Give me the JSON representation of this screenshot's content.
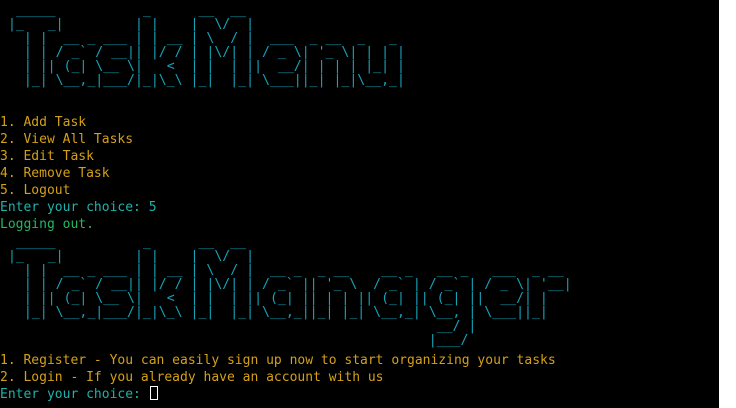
{
  "colors": {
    "background": "#000000",
    "art": "#17a2b8",
    "menu": "#d4a017",
    "prompt": "#20b2aa",
    "status": "#23b860",
    "scrollbar": "#ffffff"
  },
  "banner1": {
    "art": "  _____           _      __  __\n |_   _|         | |    |  \\/  |\n   | |  __ _ ___ | | __ | \\  / |  ___  _ __  _   _\n   | | / _` / __|| |/ / | |\\/| | / _ \\| '_ \\| | | |\n   | || (_| \\__ \\|   <  | |  | ||  __/| | | | |_| |\n   |_| \\__,_|___/|_|\\_\\ |_|  |_| \\___||_| |_|\\__,_|"
  },
  "menu1": {
    "items": [
      "1. Add Task",
      "2. View All Tasks",
      "3. Edit Task",
      "4. Remove Task",
      "5. Logout"
    ],
    "prompt": "Enter your choice: 5",
    "status": "Logging out."
  },
  "banner2": {
    "art": "  _____           _      __  __\n |_   _|         | |    |  \\/  |\n   | |  __ _ ___ | | __ | \\  / |  __ _  _ __    __ _   __ _   ___  _ __\n   | | / _` / __|| |/ / | |\\/| | / _` || '_ \\  / _` | / _` | / _ \\| '__|\n   | || (_| \\__ \\|   <  | |  | || (_| || | | || (_| || (_| ||  __/| |\n   |_| \\__,_|___/|_|\\_\\ |_|  |_| \\__,_||_| |_| \\__,_| \\__, | \\___||_|\n                                                       __/ |\n                                                      |___/"
  },
  "menu2": {
    "items": [
      "1. Register - You can easily sign up now to start organizing your tasks",
      "2. Login - If you already have an account with us"
    ],
    "prompt": "Enter your choice: "
  }
}
